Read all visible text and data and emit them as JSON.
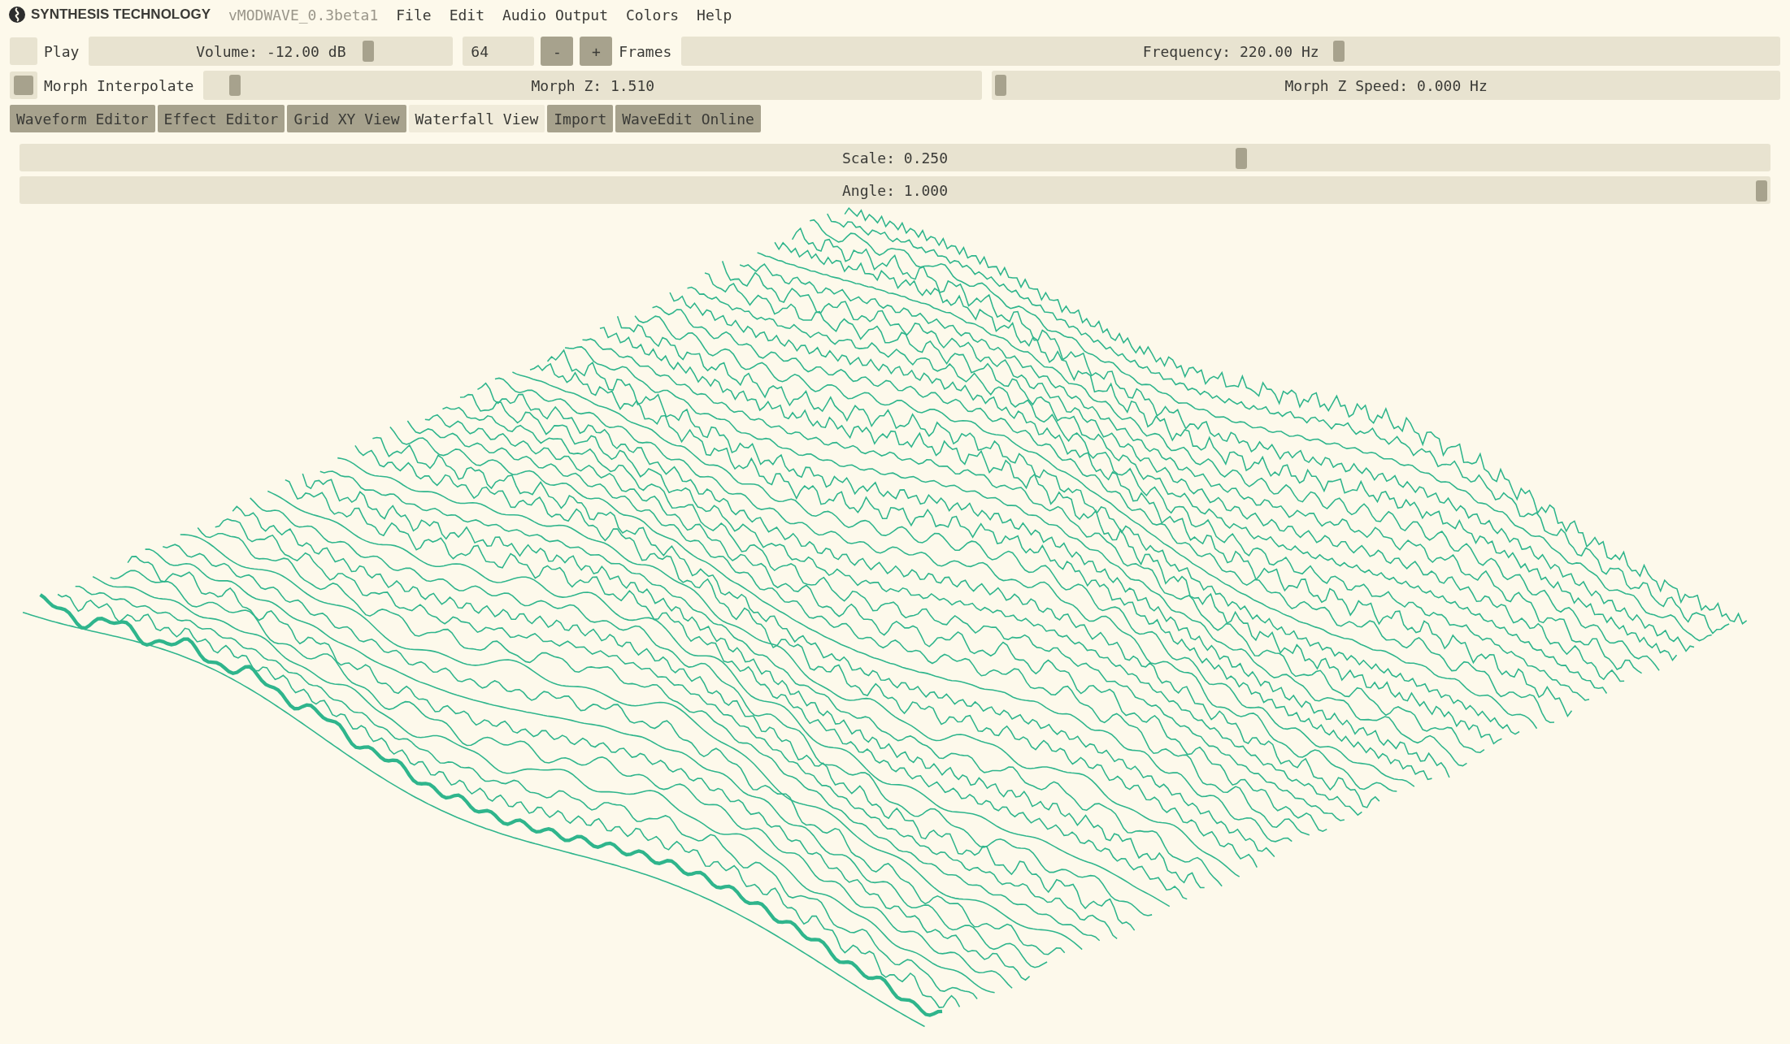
{
  "menu_bar": {
    "brand": "SYNTHESIS TECHNOLOGY",
    "version": "vMODWAVE_0.3beta1",
    "menus": [
      "File",
      "Edit",
      "Audio Output",
      "Colors",
      "Help"
    ]
  },
  "row_1": {
    "play": {
      "label": "Play",
      "checked": false
    },
    "volume": {
      "label": "Volume: -12.00 dB",
      "level": 0.78
    },
    "frames_field": {
      "value": "64"
    },
    "minus": "-",
    "plus": "+",
    "frames_label": "Frames",
    "frequency": {
      "label": "Frequency: 220.00 Hz",
      "level": 0.6
    }
  },
  "row_2": {
    "morph_interpolate": {
      "label": "Morph Interpolate",
      "checked": true
    },
    "morph_z": {
      "label": "Morph Z: 1.510",
      "level": 0.03
    },
    "morph_z_speed": {
      "label": "Morph Z Speed: 0.000 Hz",
      "level": 0.0
    }
  },
  "tabs": [
    {
      "label": "Waveform Editor",
      "selected": false
    },
    {
      "label": "Effect Editor",
      "selected": false
    },
    {
      "label": "Grid XY View",
      "selected": false
    },
    {
      "label": "Waterfall View",
      "selected": true
    },
    {
      "label": "Import",
      "selected": false
    },
    {
      "label": "WaveEdit Online",
      "selected": false
    }
  ],
  "view_sliders": [
    {
      "label": "Scale: 0.250",
      "level": 0.7
    },
    {
      "label": "Angle: 1.000",
      "level": 1.0
    }
  ]
}
